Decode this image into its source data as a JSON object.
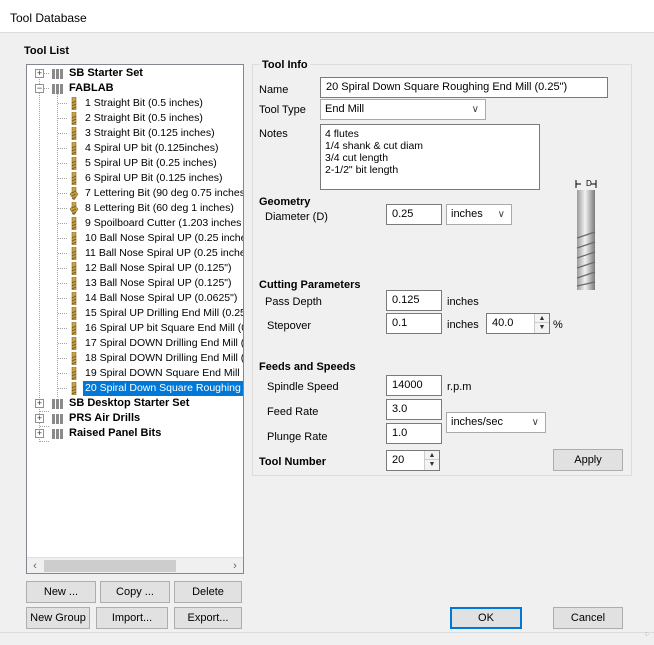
{
  "window": {
    "title": "Tool Database"
  },
  "tool_list": {
    "label": "Tool List",
    "tree": [
      {
        "label": "SB Starter Set",
        "level": 0,
        "type": "group",
        "expanded": false
      },
      {
        "label": "FABLAB",
        "level": 0,
        "type": "group",
        "expanded": true
      },
      {
        "label": "1 Straight Bit (0.5 inches)",
        "level": 1,
        "type": "tool"
      },
      {
        "label": "2 Straight Bit (0.5 inches)",
        "level": 1,
        "type": "tool"
      },
      {
        "label": "3 Straight Bit (0.125 inches)",
        "level": 1,
        "type": "tool"
      },
      {
        "label": "4 Spiral UP bit (0.125inches)",
        "level": 1,
        "type": "tool"
      },
      {
        "label": "5 Spiral UP Bit (0.25 inches)",
        "level": 1,
        "type": "tool"
      },
      {
        "label": "6 Spiral UP Bit (0.125 inches)",
        "level": 1,
        "type": "tool"
      },
      {
        "label": "7 Lettering Bit (90 deg 0.75 inches",
        "level": 1,
        "type": "tool",
        "vbit": true
      },
      {
        "label": "8 Lettering Bit (60 deg 1 inches)",
        "level": 1,
        "type": "tool",
        "vbit": true
      },
      {
        "label": "9 Spoilboard Cutter (1.203 inches",
        "level": 1,
        "type": "tool"
      },
      {
        "label": "10 Ball Nose Spiral UP (0.25 inche",
        "level": 1,
        "type": "tool"
      },
      {
        "label": "11 Ball Nose Spiral UP (0.25 inche",
        "level": 1,
        "type": "tool"
      },
      {
        "label": "12 Ball Nose Spiral UP (0.125\")",
        "level": 1,
        "type": "tool"
      },
      {
        "label": "13 Ball Nose Spiral UP (0.125\")",
        "level": 1,
        "type": "tool"
      },
      {
        "label": "14 Ball Nose Spiral UP (0.0625\")",
        "level": 1,
        "type": "tool"
      },
      {
        "label": "15 Spiral UP Drilling End Mill (0.25",
        "level": 1,
        "type": "tool"
      },
      {
        "label": "16 Spiral UP bit Square End Mill (0",
        "level": 1,
        "type": "tool"
      },
      {
        "label": "17 Spiral DOWN Drilling End Mill (0",
        "level": 1,
        "type": "tool"
      },
      {
        "label": "18  Spiral DOWN Drilling End Mill (.",
        "level": 1,
        "type": "tool"
      },
      {
        "label": "19 Spiral DOWN Square End Mill ((",
        "level": 1,
        "type": "tool"
      },
      {
        "label": "20 Spiral Down Square Roughing E",
        "level": 1,
        "type": "tool",
        "selected": true
      },
      {
        "label": "SB Desktop Starter Set",
        "level": 0,
        "type": "group",
        "expanded": false
      },
      {
        "label": "PRS Air Drills",
        "level": 0,
        "type": "group",
        "expanded": false
      },
      {
        "label": "Raised Panel Bits",
        "level": 0,
        "type": "group",
        "expanded": false
      }
    ],
    "buttons": {
      "new": "New ...",
      "copy": "Copy ...",
      "delete": "Delete",
      "new_group": "New Group",
      "import": "Import...",
      "export": "Export..."
    }
  },
  "tool_info": {
    "label": "Tool Info",
    "name_label": "Name",
    "name_value": "20 Spiral Down Square Roughing End Mill (0.25\")",
    "type_label": "Tool Type",
    "type_value": "End Mill",
    "notes_label": "Notes",
    "notes_value": "4 flutes\n1/4 shank & cut diam\n3/4 cut length\n2-1/2\" bit length"
  },
  "geometry": {
    "label": "Geometry",
    "diameter_label": "Diameter (D)",
    "diameter_value": "0.25",
    "units_value": "inches",
    "diagram_label": "D"
  },
  "cutting": {
    "label": "Cutting Parameters",
    "pass_depth_label": "Pass Depth",
    "pass_depth_value": "0.125",
    "pass_depth_unit": "inches",
    "stepover_label": "Stepover",
    "stepover_value": "0.1",
    "stepover_unit": "inches",
    "stepover_percent": "40.0",
    "percent_sign": "%"
  },
  "feeds": {
    "label": "Feeds and Speeds",
    "spindle_label": "Spindle Speed",
    "spindle_value": "14000",
    "spindle_unit": "r.p.m",
    "feed_label": "Feed Rate",
    "feed_value": "3.0",
    "rate_units_value": "inches/sec",
    "plunge_label": "Plunge Rate",
    "plunge_value": "1.0"
  },
  "tool_number": {
    "label": "Tool Number",
    "value": "20"
  },
  "actions": {
    "apply": "Apply",
    "ok": "OK",
    "cancel": "Cancel"
  },
  "colors": {
    "selection": "#0078d7",
    "default_button_border": "#0078d7",
    "dialog_bg": "#f0f0f0"
  }
}
